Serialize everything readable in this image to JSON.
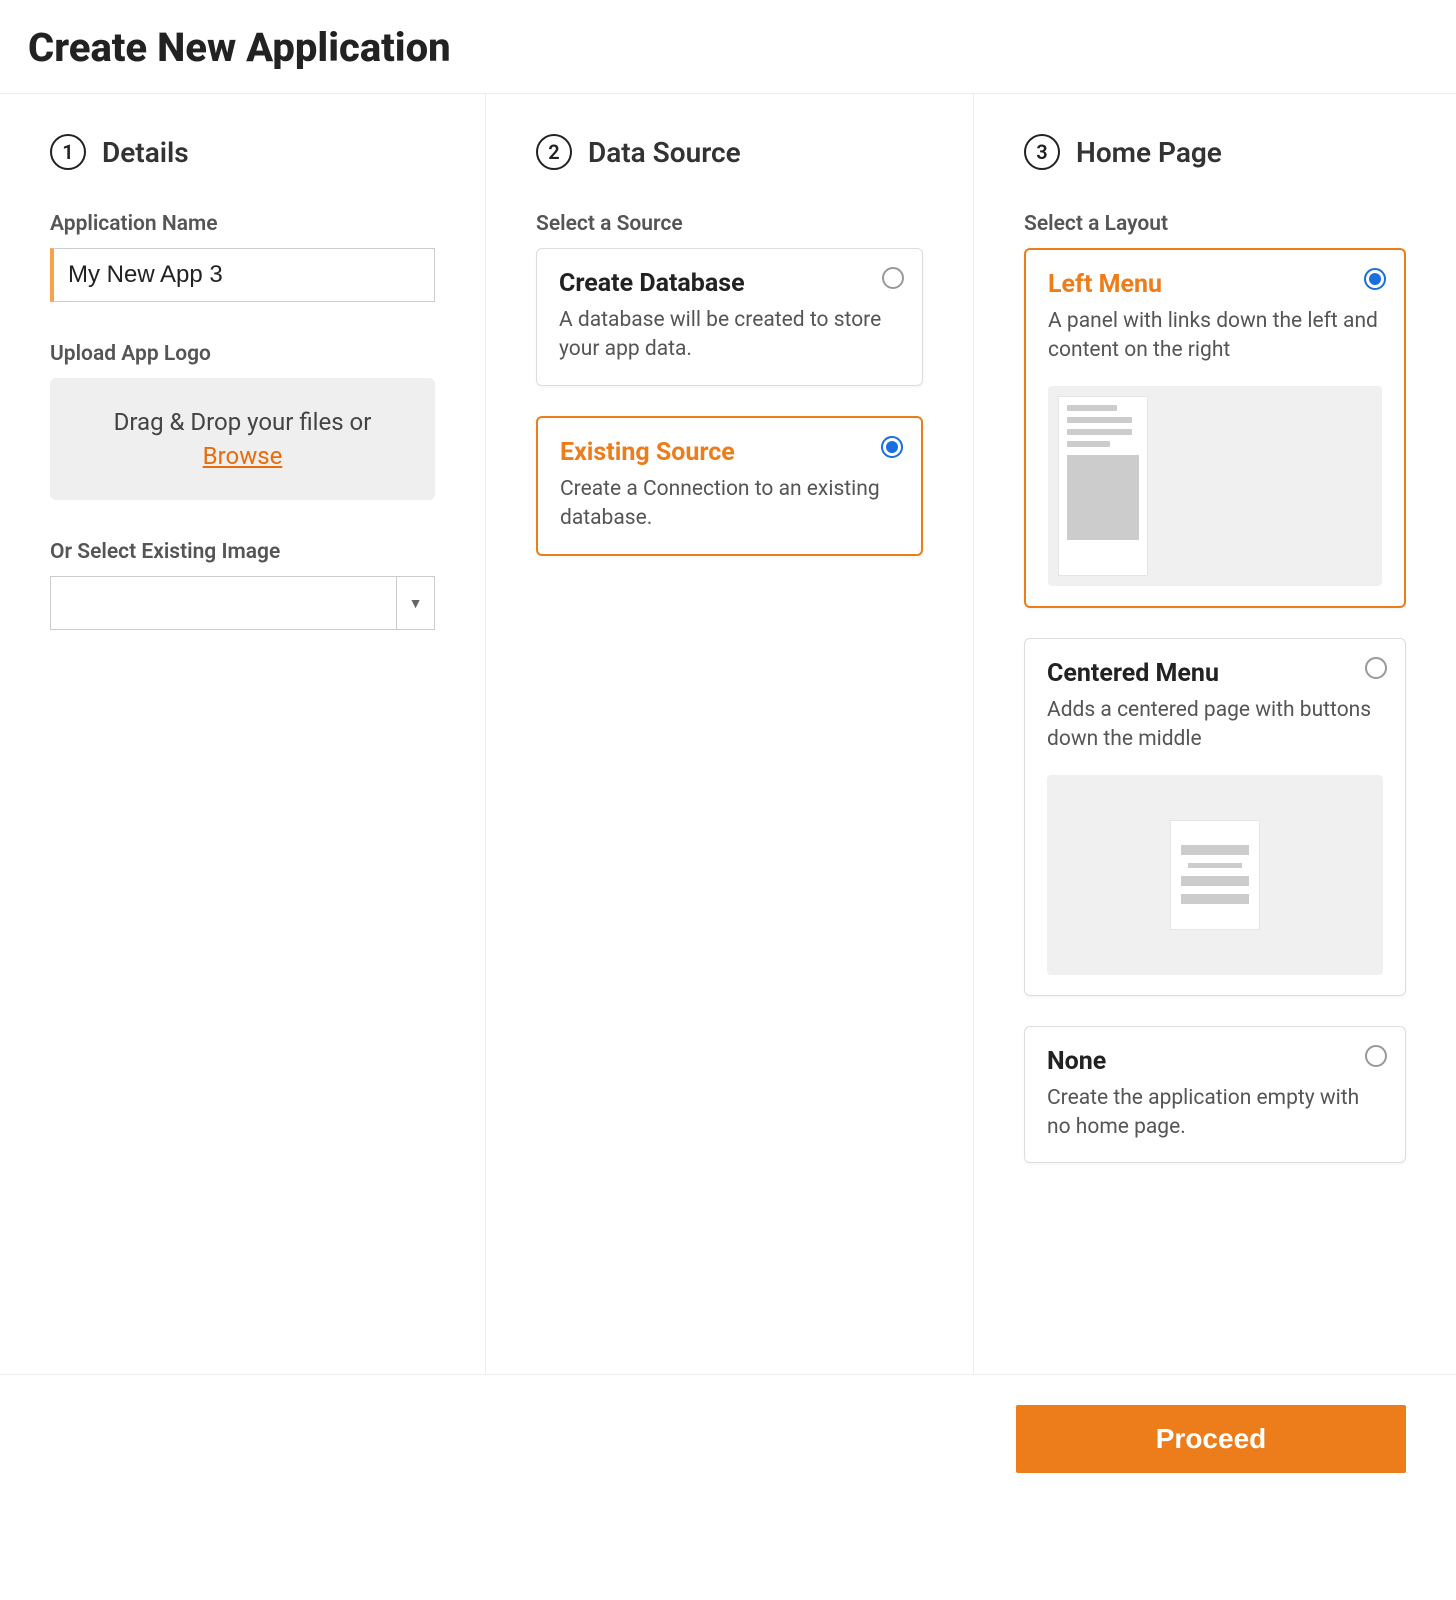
{
  "header": {
    "title": "Create New Application"
  },
  "steps": {
    "details": {
      "num": "1",
      "title": "Details"
    },
    "source": {
      "num": "2",
      "title": "Data Source"
    },
    "layout": {
      "num": "3",
      "title": "Home Page"
    }
  },
  "details": {
    "name_label": "Application Name",
    "name_value": "My New App 3",
    "upload_label": "Upload App Logo",
    "dropzone_text": "Drag & Drop your files or",
    "browse_text": "Browse",
    "existing_image_label": "Or Select Existing Image"
  },
  "source": {
    "section_label": "Select a Source",
    "options": [
      {
        "title": "Create Database",
        "desc": "A database will be created to store your app data.",
        "selected": false
      },
      {
        "title": "Existing Source",
        "desc": "Create a Connection to an existing database.",
        "selected": true
      }
    ]
  },
  "layout": {
    "section_label": "Select a Layout",
    "options": [
      {
        "title": "Left Menu",
        "desc": "A panel with links down the left and content on the right",
        "selected": true
      },
      {
        "title": "Centered Menu",
        "desc": "Adds a centered page with buttons down the middle",
        "selected": false
      },
      {
        "title": "None",
        "desc": "Create the application empty with no home page.",
        "selected": false
      }
    ]
  },
  "footer": {
    "proceed_label": "Proceed"
  }
}
